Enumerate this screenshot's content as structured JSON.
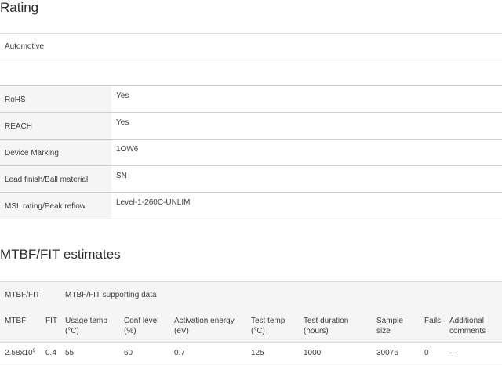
{
  "rating": {
    "title": "Rating",
    "value": "Automotive"
  },
  "specs": [
    {
      "label": "RoHS",
      "value": "Yes"
    },
    {
      "label": "REACH",
      "value": "Yes"
    },
    {
      "label": "Device Marking",
      "value": "1OW6"
    },
    {
      "label": "Lead finish/Ball material",
      "value": "SN"
    },
    {
      "label": "MSL rating/Peak reflow",
      "value": "Level-1-260C-UNLIM"
    }
  ],
  "mtbf": {
    "title": "MTBF/FIT estimates",
    "header_fit": "MTBF/FIT",
    "header_support": "MTBF/FIT supporting data",
    "columns": {
      "mtbf": "MTBF",
      "fit": "FIT",
      "usage_temp_1": "Usage temp",
      "usage_temp_2": "(°C)",
      "conf_1": "Conf level",
      "conf_2": "(%)",
      "act_1": "Activation energy",
      "act_2": "(eV)",
      "test_temp_1": "Test temp",
      "test_temp_2": "(°C)",
      "dur_1": "Test duration",
      "dur_2": "(hours)",
      "sample_1": "Sample",
      "sample_2": "size",
      "fails": "Fails",
      "add_1": "Additional",
      "add_2": "comments"
    },
    "row": {
      "mtbf_base": "2.58x10",
      "mtbf_exp": "9",
      "fit": "0.4",
      "usage_temp": "55",
      "conf": "60",
      "act": "0.7",
      "test_temp": "125",
      "dur": "1000",
      "sample": "30076",
      "fails": "0",
      "add": "—"
    }
  }
}
